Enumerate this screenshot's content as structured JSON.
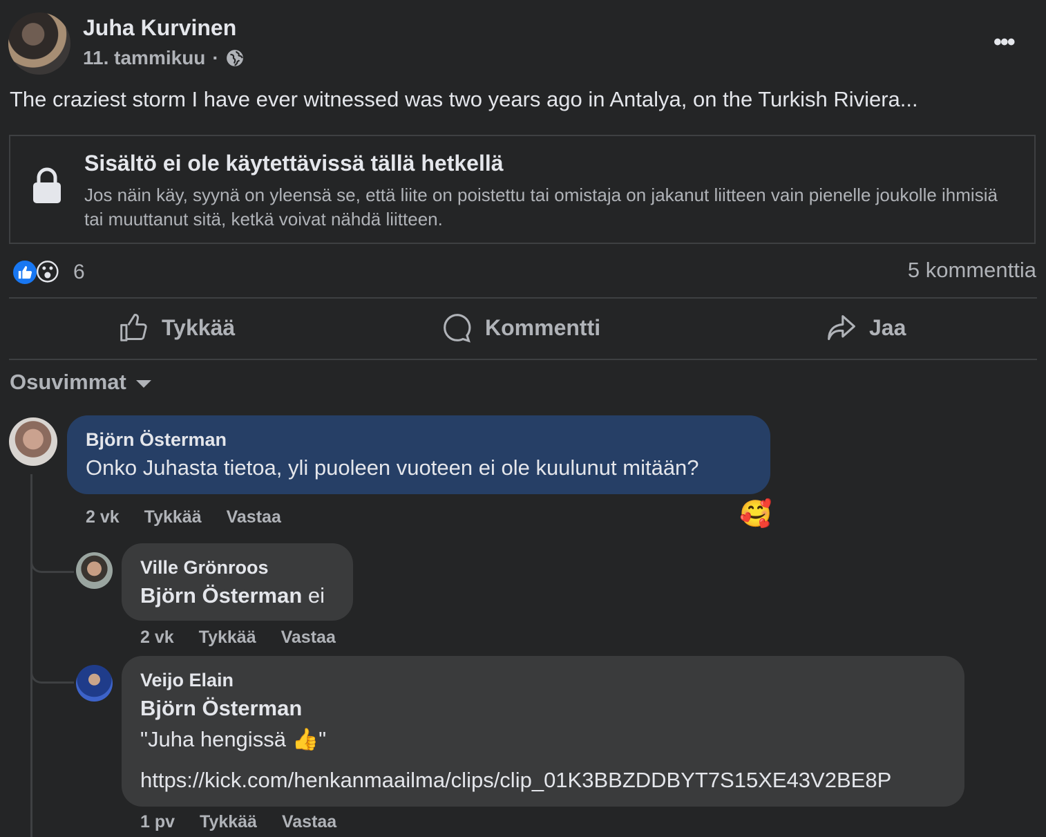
{
  "post": {
    "author": "Juha Kurvinen",
    "date": "11. tammikuu",
    "separator": "·",
    "more_label": "•••",
    "text": "The craziest storm I have ever witnessed was two years ago in Antalya, on the Turkish Riviera...",
    "unavailable_title": "Sisältö ei ole käytettävissä tällä hetkellä",
    "unavailable_desc": "Jos näin käy, syynä on yleensä se, että liite on poistettu tai omistaja on jakanut liitteen vain pienelle joukolle ihmisiä tai muuttanut sitä, ketkä voivat nähdä liitteen.",
    "reaction_count": "6",
    "reaction_wow": "😮",
    "comment_count": "5 kommenttia"
  },
  "actions": {
    "like": "Tykkää",
    "comment": "Kommentti",
    "share": "Jaa"
  },
  "sort": {
    "label": "Osuvimmat"
  },
  "comments": [
    {
      "author": "Björn Österman",
      "text": "Onko Juhasta tietoa, yli puoleen vuoteen ei ole kuulunut mitään?",
      "time": "2 vk",
      "like": "Tykkää",
      "reply": "Vastaa",
      "reaction": "🥰"
    },
    {
      "author": "Ville Grönroos",
      "tag": "Björn Österman",
      "text": " ei",
      "time": "2 vk",
      "like": "Tykkää",
      "reply": "Vastaa"
    },
    {
      "author": "Veijo Elain",
      "tag": "Björn Österman",
      "line1": "\"Juha hengissä 👍\"",
      "link": "https://kick.com/henkanmaailma/clips/clip_01K3BBZDDBYT7S15XE43V2BE8P",
      "time": "1 pv",
      "like": "Tykkää",
      "reply": "Vastaa"
    }
  ],
  "colors": {
    "background": "#242526",
    "bubble": "#3a3b3c",
    "highlight_bubble": "#263f66",
    "like_blue": "#1877f2"
  }
}
